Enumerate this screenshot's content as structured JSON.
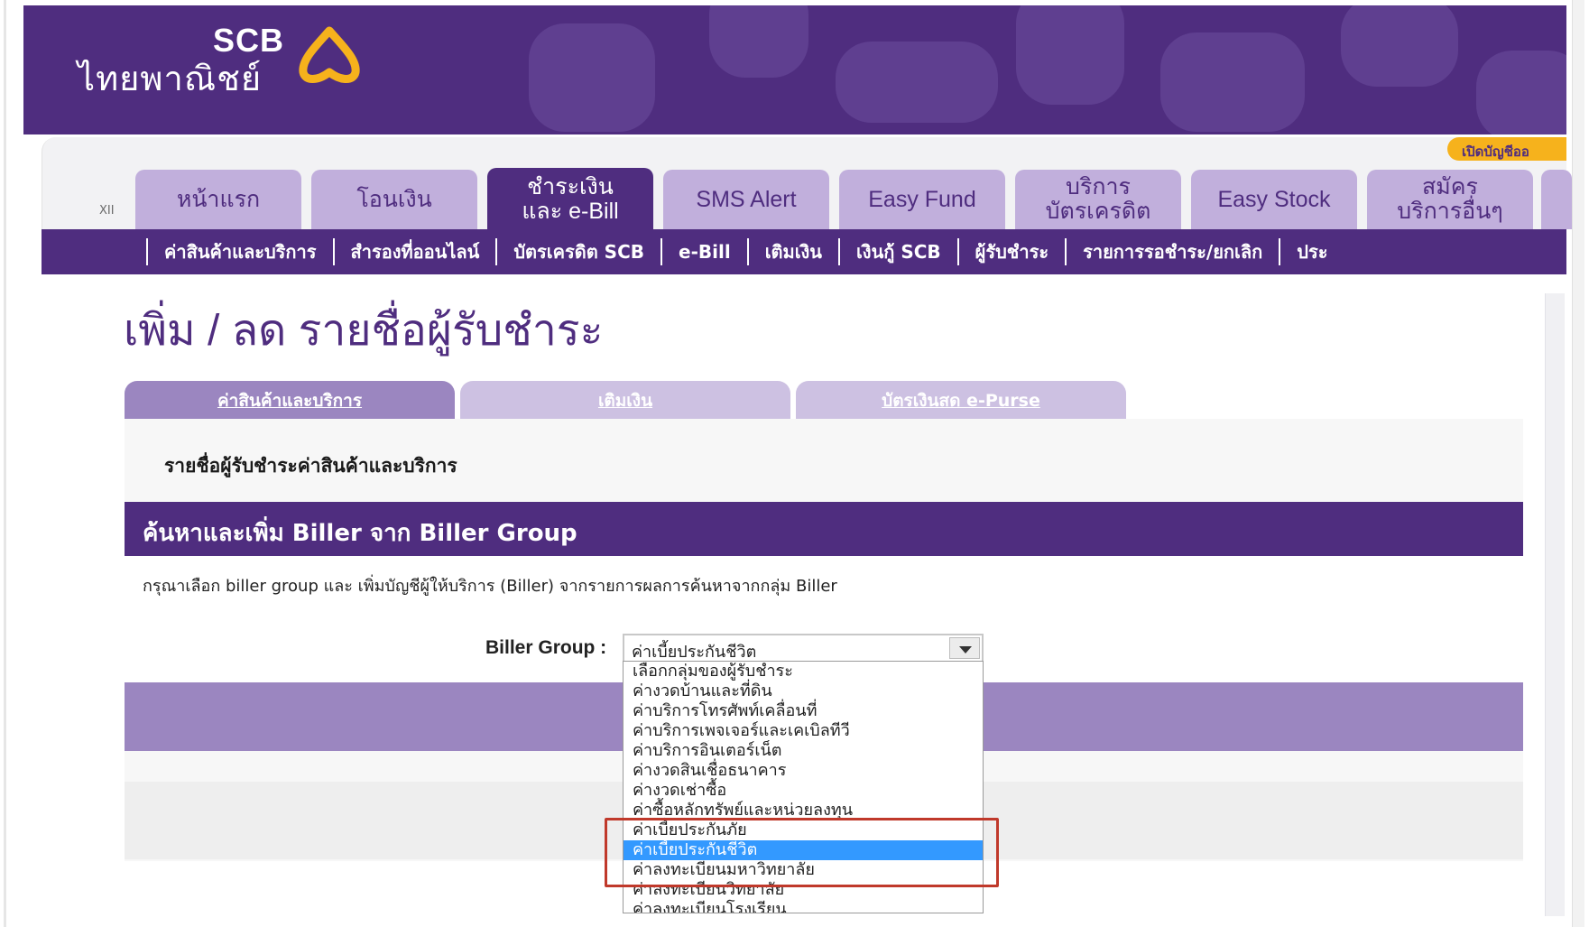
{
  "brand": {
    "logo_en": "SCB",
    "logo_th": "ไทยพาณิชย์",
    "logo_icon": "scb-lotus-icon",
    "colors": {
      "primary_purple": "#4f2d7f",
      "light_purple": "#c1afdc",
      "accent_gold": "#f6b21c",
      "select_blue": "#3399ff",
      "highlight_red": "#c0392b"
    }
  },
  "header": {
    "open_account_label": "เปิดบัญชีออ"
  },
  "nav": {
    "marker": "XII",
    "tabs": [
      {
        "label": "หน้าแรก"
      },
      {
        "label": "โอนเงิน"
      },
      {
        "label": "ชำระเงิน\nและ e-Bill"
      },
      {
        "label": "SMS Alert"
      },
      {
        "label": "Easy Fund"
      },
      {
        "label": "บริการ\nบัตรเครดิต"
      },
      {
        "label": "Easy Stock"
      },
      {
        "label": "สมัคร\nบริการอื่นๆ"
      }
    ]
  },
  "subnav": {
    "items": [
      {
        "label": "ค่าสินค้าและบริการ"
      },
      {
        "label": "สำรองที่ออนไลน์"
      },
      {
        "label": "บัตรเครดิต SCB"
      },
      {
        "label": "e-Bill"
      },
      {
        "label": "เติมเงิน"
      },
      {
        "label": "เงินกู้ SCB"
      },
      {
        "label": "ผู้รับชำระ"
      },
      {
        "label": "รายการรอชำระ/ยกเลิก"
      },
      {
        "label": "ประ"
      }
    ]
  },
  "page": {
    "title": "เพิ่ม / ลด รายชื่อผู้รับชำระ",
    "content_tabs": [
      {
        "label": "ค่าสินค้าและบริการ"
      },
      {
        "label": "เติมเงิน"
      },
      {
        "label": "บัตรเงินสด e-Purse"
      }
    ],
    "section_label": "รายชื่อผู้รับชำระค่าสินค้าและบริการ",
    "search_header": "ค้นหาและเพิ่ม Biller จาก Biller Group",
    "instruction": "กรุณาเลือก biller group และ เพิ่มบัญชีผู้ให้บริการ (Biller) จากรายการผลการค้นหาจากกลุ่ม Biller",
    "biller_group_label": "Biller Group :",
    "biller_group_value": "ค่าเบี้ยประกันชีวิต",
    "dropdown_options": [
      "เลือกกลุ่มของผู้รับชำระ",
      "ค่างวดบ้านและที่ดิน",
      "ค่าบริการโทรศัพท์เคลื่อนที่",
      "ค่าบริการเพจเจอร์และเคเบิลทีวี",
      "ค่าบริการอินเตอร์เน็ต",
      "ค่างวดสินเชื่อธนาคาร",
      "ค่างวดเช่าซื้อ",
      "ค่าซื้อหลักทรัพย์และหน่วยลงทุน",
      "ค่าเบี้ยประกันภัย",
      "ค่าเบี้ยประกันชีวิต",
      "ค่าลงทะเบียนมหาวิทยาลัย",
      "ค่าลงทะเบียนวิทยาลัย",
      "ค่าลงทะเบียนโรงเรียน"
    ]
  }
}
